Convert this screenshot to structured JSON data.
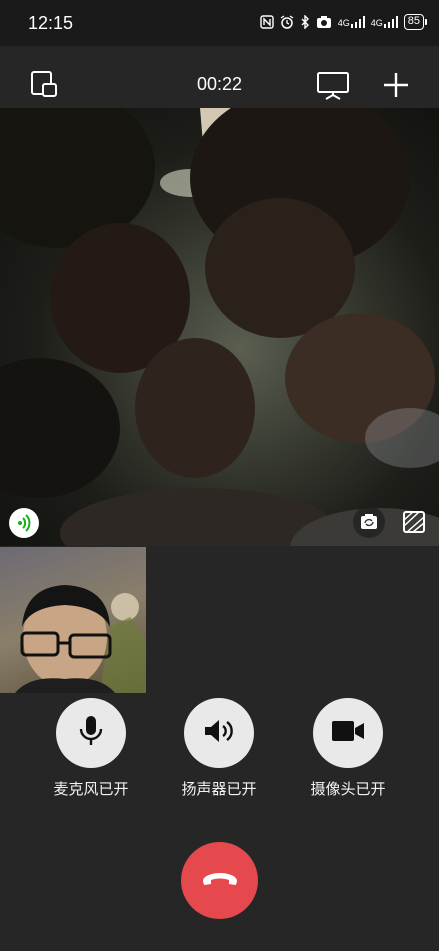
{
  "status_bar": {
    "time": "12:15",
    "network_1": "4G",
    "network_2": "4G",
    "battery": "85",
    "icons": [
      "nfc-icon",
      "alarm-icon",
      "bluetooth-icon",
      "camera-icon",
      "signal-icon",
      "signal-icon",
      "battery-icon"
    ]
  },
  "call": {
    "duration": "00:22",
    "top_icons": [
      "minimize-window-icon",
      "screen-share-icon",
      "add-icon"
    ]
  },
  "remote_video": {
    "overlay_icons": [
      "audio-signal-icon",
      "switch-camera-icon",
      "video-effects-icon"
    ]
  },
  "controls": {
    "mic_label": "麦克风已开",
    "speaker_label": "扬声器已开",
    "camera_label": "摄像头已开"
  },
  "colors": {
    "background": "#262626",
    "control_circle": "#e9e9e9",
    "hangup": "#e5484d",
    "signal_accent": "#1aad19"
  }
}
